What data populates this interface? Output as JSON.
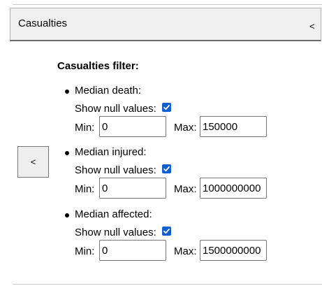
{
  "section": {
    "title": "Casualties",
    "toggle_glyph": "<"
  },
  "side_button": {
    "label": "<"
  },
  "filter": {
    "heading": "Casualties filter:",
    "show_null_label": "Show null values:",
    "min_label": "Min:",
    "max_label": "Max:",
    "groups": [
      {
        "label": "Median death:",
        "show_null": true,
        "min": "0",
        "max": "150000"
      },
      {
        "label": "Median injured:",
        "show_null": true,
        "min": "0",
        "max": "1000000000"
      },
      {
        "label": "Median affected:",
        "show_null": true,
        "min": "0",
        "max": "1500000000"
      }
    ]
  },
  "colors": {
    "checkbox_accent": "#0f5fd1",
    "header_background": "#f0f0f0"
  }
}
